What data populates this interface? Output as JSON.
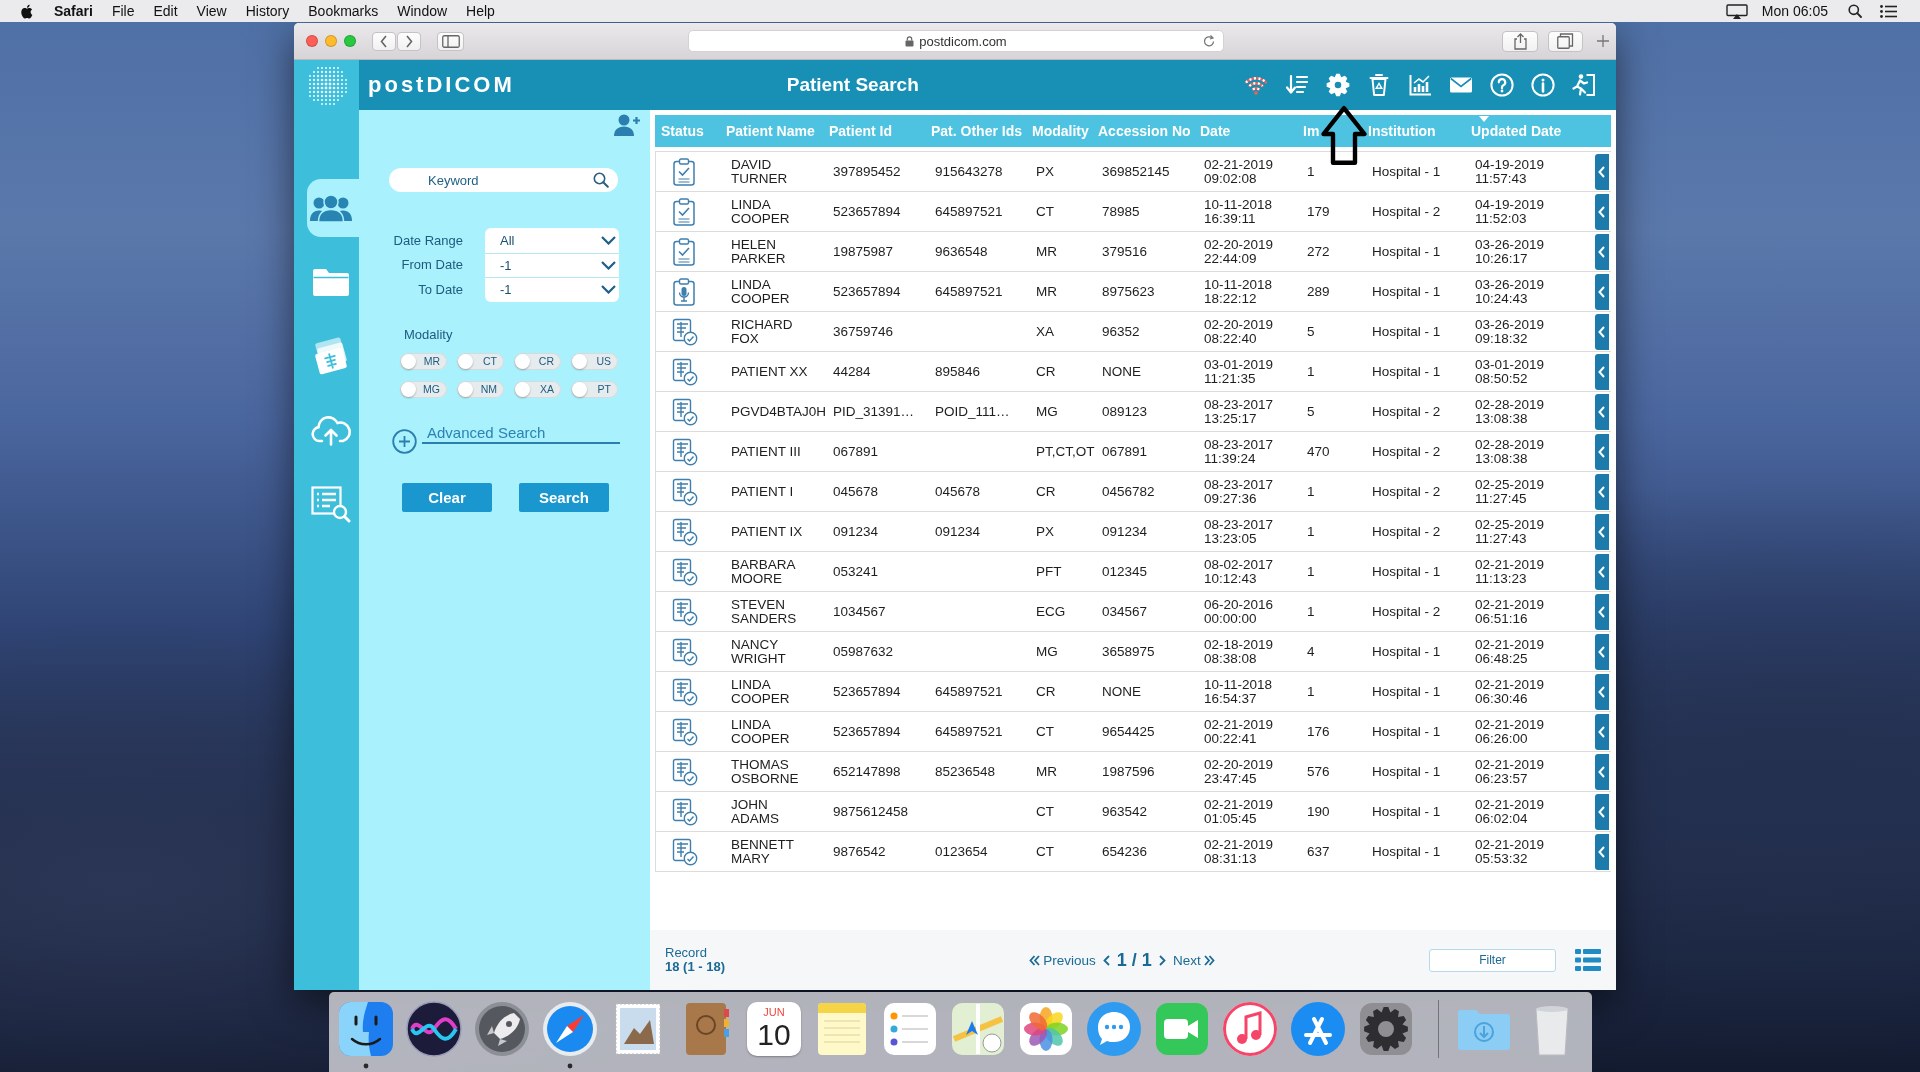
{
  "menu_bar": {
    "app": "Safari",
    "menus": [
      "File",
      "Edit",
      "View",
      "History",
      "Bookmarks",
      "Window",
      "Help"
    ],
    "clock": "Mon 06:05"
  },
  "browser": {
    "address": "postdicom.com"
  },
  "app": {
    "logo": "postDICOM",
    "title": "Patient Search"
  },
  "sidebar": {
    "items": [
      {
        "selected": true
      },
      {
        "selected": false
      },
      {
        "selected": false
      },
      {
        "selected": false
      },
      {
        "selected": false
      }
    ]
  },
  "search_panel": {
    "keyword": {
      "placeholder": "Keyword"
    },
    "filters": [
      {
        "label": "Date Range",
        "value": "All"
      },
      {
        "label": "From Date",
        "value": "-1"
      },
      {
        "label": "To Date",
        "value": "-1"
      }
    ],
    "modality_label": "Modality",
    "modalities": [
      {
        "label": "MR",
        "on": false
      },
      {
        "label": "CT",
        "on": false
      },
      {
        "label": "CR",
        "on": false
      },
      {
        "label": "US",
        "on": false
      },
      {
        "label": "MG",
        "on": false
      },
      {
        "label": "NM",
        "on": false
      },
      {
        "label": "XA",
        "on": false
      },
      {
        "label": "PT",
        "on": false
      }
    ],
    "advanced_search": "Advanced Search",
    "buttons": [
      "Clear",
      "Search"
    ]
  },
  "table": {
    "columns": [
      {
        "label": "Status",
        "sorted": false
      },
      {
        "label": "Patient Name",
        "sorted": false
      },
      {
        "label": "Patient Id",
        "sorted": false
      },
      {
        "label": "Pat. Other Ids",
        "sorted": false
      },
      {
        "label": "Modality",
        "sorted": false
      },
      {
        "label": "Accession No",
        "sorted": false
      },
      {
        "label": "Date",
        "sorted": false
      },
      {
        "label": "Im",
        "sorted": false
      },
      {
        "label": "Institution",
        "sorted": false
      },
      {
        "label": "Updated Date",
        "sorted": true
      }
    ],
    "rows": [
      {
        "kind": "report",
        "name": "DAVID\nTURNER",
        "patient_id": "397895452",
        "other_ids": "915643278",
        "modality": "PX",
        "accession": "369852145",
        "date": "02-21-2019 09:02:08",
        "images": "1",
        "institution": "Hospital - 1",
        "updated": "04-19-2019 11:57:43"
      },
      {
        "kind": "report",
        "name": "LINDA\nCOOPER",
        "patient_id": "523657894",
        "other_ids": "645897521",
        "modality": "CT",
        "accession": "78985",
        "date": "10-11-2018 16:39:11",
        "images": "179",
        "institution": "Hospital - 2",
        "updated": "04-19-2019 11:52:03"
      },
      {
        "kind": "report",
        "name": "HELEN\nPARKER",
        "patient_id": "19875987",
        "other_ids": "9636548",
        "modality": "MR",
        "accession": "379516",
        "date": "02-20-2019 22:44:09",
        "images": "272",
        "institution": "Hospital - 1",
        "updated": "03-26-2019 10:26:17"
      },
      {
        "kind": "dictation",
        "name": "LINDA\nCOOPER",
        "patient_id": "523657894",
        "other_ids": "645897521",
        "modality": "MR",
        "accession": "8975623",
        "date": "10-11-2018 18:22:12",
        "images": "289",
        "institution": "Hospital - 1",
        "updated": "03-26-2019 10:24:43"
      },
      {
        "kind": "study",
        "name": "RICHARD\nFOX",
        "patient_id": "36759746",
        "modality": "XA",
        "accession": "96352",
        "date": "02-20-2019 08:22:40",
        "images": "5",
        "institution": "Hospital - 1",
        "updated": "03-26-2019 09:18:32"
      },
      {
        "kind": "study",
        "name": "PATIENT XX",
        "patient_id": "44284",
        "other_ids": "895846",
        "modality": "CR",
        "accession": "NONE",
        "date": "03-01-2019 11:21:35",
        "images": "1",
        "institution": "Hospital - 1",
        "updated": "03-01-2019 08:50:52"
      },
      {
        "kind": "study",
        "name": "PGVD4BTAJ0H",
        "patient_id": "PID_31391…",
        "other_ids": "POID_111…",
        "modality": "MG",
        "accession": "089123",
        "date": "08-23-2017 13:25:17",
        "images": "5",
        "institution": "Hospital - 2",
        "updated": "02-28-2019 13:08:38"
      },
      {
        "kind": "study",
        "name": "PATIENT III",
        "patient_id": "067891",
        "modality": "PT,CT,OT",
        "accession": "067891",
        "date": "08-23-2017 11:39:24",
        "images": "470",
        "institution": "Hospital - 2",
        "updated": "02-28-2019 13:08:38"
      },
      {
        "kind": "study",
        "name": "PATIENT I",
        "patient_id": "045678",
        "other_ids": "045678",
        "modality": "CR",
        "accession": "0456782",
        "date": "08-23-2017 09:27:36",
        "images": "1",
        "institution": "Hospital - 2",
        "updated": "02-25-2019 11:27:45"
      },
      {
        "kind": "study",
        "name": "PATIENT IX",
        "patient_id": "091234",
        "other_ids": "091234",
        "modality": "PX",
        "accession": "091234",
        "date": "08-23-2017 13:23:05",
        "images": "1",
        "institution": "Hospital - 2",
        "updated": "02-25-2019 11:27:43"
      },
      {
        "kind": "study",
        "name": "BARBARA\nMOORE",
        "patient_id": "053241",
        "modality": "PFT",
        "accession": "012345",
        "date": "08-02-2017 10:12:43",
        "images": "1",
        "institution": "Hospital - 1",
        "updated": "02-21-2019 11:13:23"
      },
      {
        "kind": "study",
        "name": "STEVEN\nSANDERS",
        "patient_id": "1034567",
        "modality": "ECG",
        "accession": "034567",
        "date": "06-20-2016 00:00:00",
        "images": "1",
        "institution": "Hospital - 2",
        "updated": "02-21-2019 06:51:16"
      },
      {
        "kind": "study",
        "name": "NANCY\nWRIGHT",
        "patient_id": "05987632",
        "modality": "MG",
        "accession": "3658975",
        "date": "02-18-2019 08:38:08",
        "images": "4",
        "institution": "Hospital - 1",
        "updated": "02-21-2019 06:48:25"
      },
      {
        "kind": "study",
        "name": "LINDA\nCOOPER",
        "patient_id": "523657894",
        "other_ids": "645897521",
        "modality": "CR",
        "accession": "NONE",
        "date": "10-11-2018 16:54:37",
        "images": "1",
        "institution": "Hospital - 1",
        "updated": "02-21-2019 06:30:46"
      },
      {
        "kind": "study",
        "name": "LINDA\nCOOPER",
        "patient_id": "523657894",
        "other_ids": "645897521",
        "modality": "CT",
        "accession": "9654425",
        "date": "02-21-2019 00:22:41",
        "images": "176",
        "institution": "Hospital - 1",
        "updated": "02-21-2019 06:26:00"
      },
      {
        "kind": "study",
        "name": "THOMAS\nOSBORNE",
        "patient_id": "652147898",
        "other_ids": "85236548",
        "modality": "MR",
        "accession": "1987596",
        "date": "02-20-2019 23:47:45",
        "images": "576",
        "institution": "Hospital - 1",
        "updated": "02-21-2019 06:23:57"
      },
      {
        "kind": "study",
        "name": "JOHN\nADAMS",
        "patient_id": "9875612458",
        "modality": "CT",
        "accession": "963542",
        "date": "02-21-2019 01:05:45",
        "images": "190",
        "institution": "Hospital - 1",
        "updated": "02-21-2019 06:02:04"
      },
      {
        "kind": "study",
        "name": "BENNETT\nMARY",
        "patient_id": "9876542",
        "other_ids": "0123654",
        "modality": "CT",
        "accession": "654236",
        "date": "02-21-2019 08:31:13",
        "images": "637",
        "institution": "Hospital - 1",
        "updated": "02-21-2019 05:53:32"
      }
    ]
  },
  "footer": {
    "record_label": "Record",
    "record_count": "18 (1 - 18)",
    "previous": "Previous",
    "page": "1 / 1",
    "next": "Next",
    "filter": "Filter"
  },
  "dock": {
    "apps": [
      {
        "running": true
      },
      {
        "running": false
      },
      {
        "running": false
      },
      {
        "running": true
      },
      {
        "running": false
      },
      {
        "running": false
      },
      {
        "running": false
      },
      {
        "running": false
      },
      {
        "running": false
      },
      {
        "running": false
      },
      {
        "running": false
      },
      {
        "running": false
      },
      {
        "running": false
      },
      {
        "running": false
      },
      {
        "running": false
      },
      {
        "running": false
      },
      {
        "running": false
      },
      {
        "running": false
      }
    ],
    "calendar": {
      "month": "JUN",
      "day": "10"
    }
  }
}
